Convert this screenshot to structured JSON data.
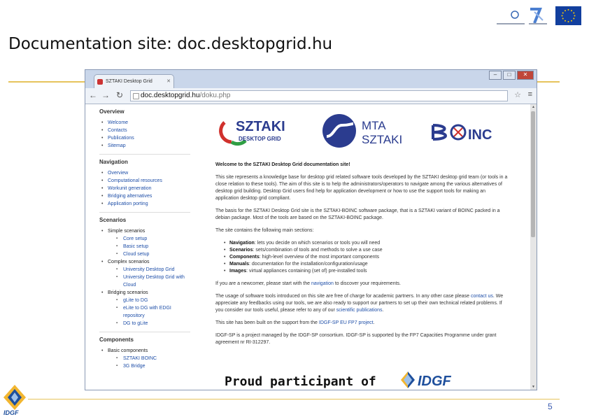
{
  "slide": {
    "title": "Documentation site: doc.desktopgrid.hu",
    "page_number": "5",
    "colors": {
      "accent_rule": "#e6c35c",
      "eu_flag": "#123f9e",
      "link": "#1f4fa8"
    }
  },
  "browser": {
    "tab_title": "SZTAKI Desktop Grid",
    "window_buttons": [
      "–",
      "□",
      "✕"
    ],
    "url_host": "doc.desktopgrid.hu",
    "url_path": "/doku.php"
  },
  "sidebar": {
    "sections": [
      {
        "heading": "Overview",
        "items": [
          "Welcome",
          "Contacts",
          "Publications",
          "Sitemap"
        ]
      },
      {
        "heading": "Navigation",
        "items": [
          "Overview",
          "Computational resources",
          "Workunit generation",
          "Bridging alternatives",
          "Application porting"
        ]
      },
      {
        "heading": "Scenarios"
      },
      {
        "heading": "Components"
      }
    ],
    "scenarios": {
      "simple": {
        "label": "Simple scenarios",
        "items": [
          "Core setup",
          "Basic setup",
          "Cloud setup"
        ]
      },
      "complex": {
        "label": "Complex scenarios",
        "items": [
          "University Desktop Grid",
          "University Desktop Grid with Cloud"
        ]
      },
      "bridging": {
        "label": "Bridging scenarios",
        "items": [
          "gLite to DG",
          "eLite to DG with EDGI repository",
          "DG to gLite"
        ]
      }
    },
    "components": {
      "label": "Basic components",
      "items": [
        "SZTAKI BOINC",
        "3G Bridge"
      ]
    }
  },
  "logos": {
    "sztaki": "SZTAKI",
    "sztaki_sub": "DESKTOP GRID",
    "mta_line1": "MTA",
    "mta_line2": "SZTAKI",
    "boinc": "BOINC"
  },
  "content": {
    "welcome": "Welcome to the SZTAKI Desktop Grid documentation site!",
    "p1": "This site represents a knowledge base for desktop grid related software tools developed by the SZTAKI desktop grid team (or tools in a close relation to these tools). The aim of this site is to help the administrators/operators to navigate among the various alternatives of desktop grid building. Desktop Grid users find help for application development or how to use the support tools for making an application desktop grid compliant.",
    "p2": "The basis for the SZTAKI Desktop Grid site is the SZTAKI-BOINC software package, that is a SZTAKI variant of BOINC packed in a debian package. Most of the tools are based on the SZTAKI-BOINC package.",
    "p3": "The site contains the following main sections:",
    "sections": [
      {
        "name": "Navigation",
        "desc": ": lets you decide on which scenarios or tools you will need"
      },
      {
        "name": "Scenarios",
        "desc": ": sets/combination of tools and methods to solve a use case"
      },
      {
        "name": "Components",
        "desc": ": high-level overview of the most important components"
      },
      {
        "name": "Manuals",
        "desc": ": documentation for the installation/configuration/usage"
      },
      {
        "name": "Images",
        "desc": ": virtual appliances containing (set of) pre-installed tools"
      }
    ],
    "p4_start": "If you are a newcomer, please start with the ",
    "p4_link": "navigation",
    "p4_end": " to discover your requirements.",
    "p5_start": "The usage of software tools introduced on this site are free of charge for academic partners. In any other case please ",
    "p5_link": "contact us",
    "p5_mid": ". We appreciate any feedbacks using our tools, we are also ready to support our partners to set up their own technical related problems. If you consider our tools useful, please refer to any of our ",
    "p5_link2": "scientific publications",
    "p5_end": ".",
    "p6_start": "This site has been built on the support from the ",
    "p6_link": "IDGF-SP EU FP7 project",
    "p6_end": ".",
    "p7": "IDGF-SP is a project managed by the IDGF-SP consortium. IDGF-SP is supported by the FP7 Capacities Programme under grant agreement nr RI-312297."
  },
  "footer_banner": {
    "text": "Proud participant of",
    "logo": "IDGF"
  }
}
